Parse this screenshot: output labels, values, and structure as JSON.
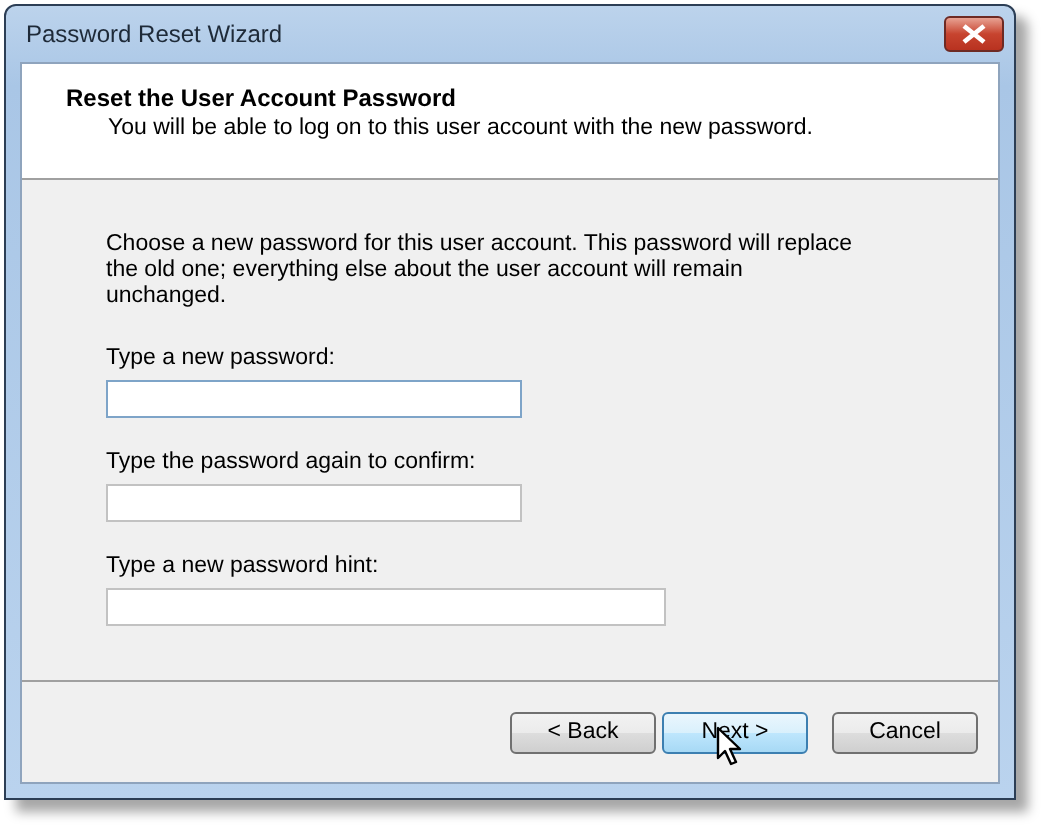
{
  "window": {
    "title": "Password Reset Wizard"
  },
  "header": {
    "title": "Reset the User Account Password",
    "subtitle": "You will be able to log on to this user account with the new password."
  },
  "intro": "Choose a new password for this user account. This password will replace the old one; everything else about the user account will remain unchanged.",
  "fields": [
    {
      "label": "Type a new password:",
      "focused": true,
      "kind": "short"
    },
    {
      "label": "Type the password again to confirm:",
      "focused": false,
      "kind": "short"
    },
    {
      "label": "Type a new password hint:",
      "focused": false,
      "kind": "long"
    }
  ],
  "buttons": [
    {
      "label": "< Back",
      "hovered": false
    },
    {
      "label": "Next >",
      "hovered": true
    },
    {
      "label": "Cancel",
      "hovered": false
    }
  ]
}
